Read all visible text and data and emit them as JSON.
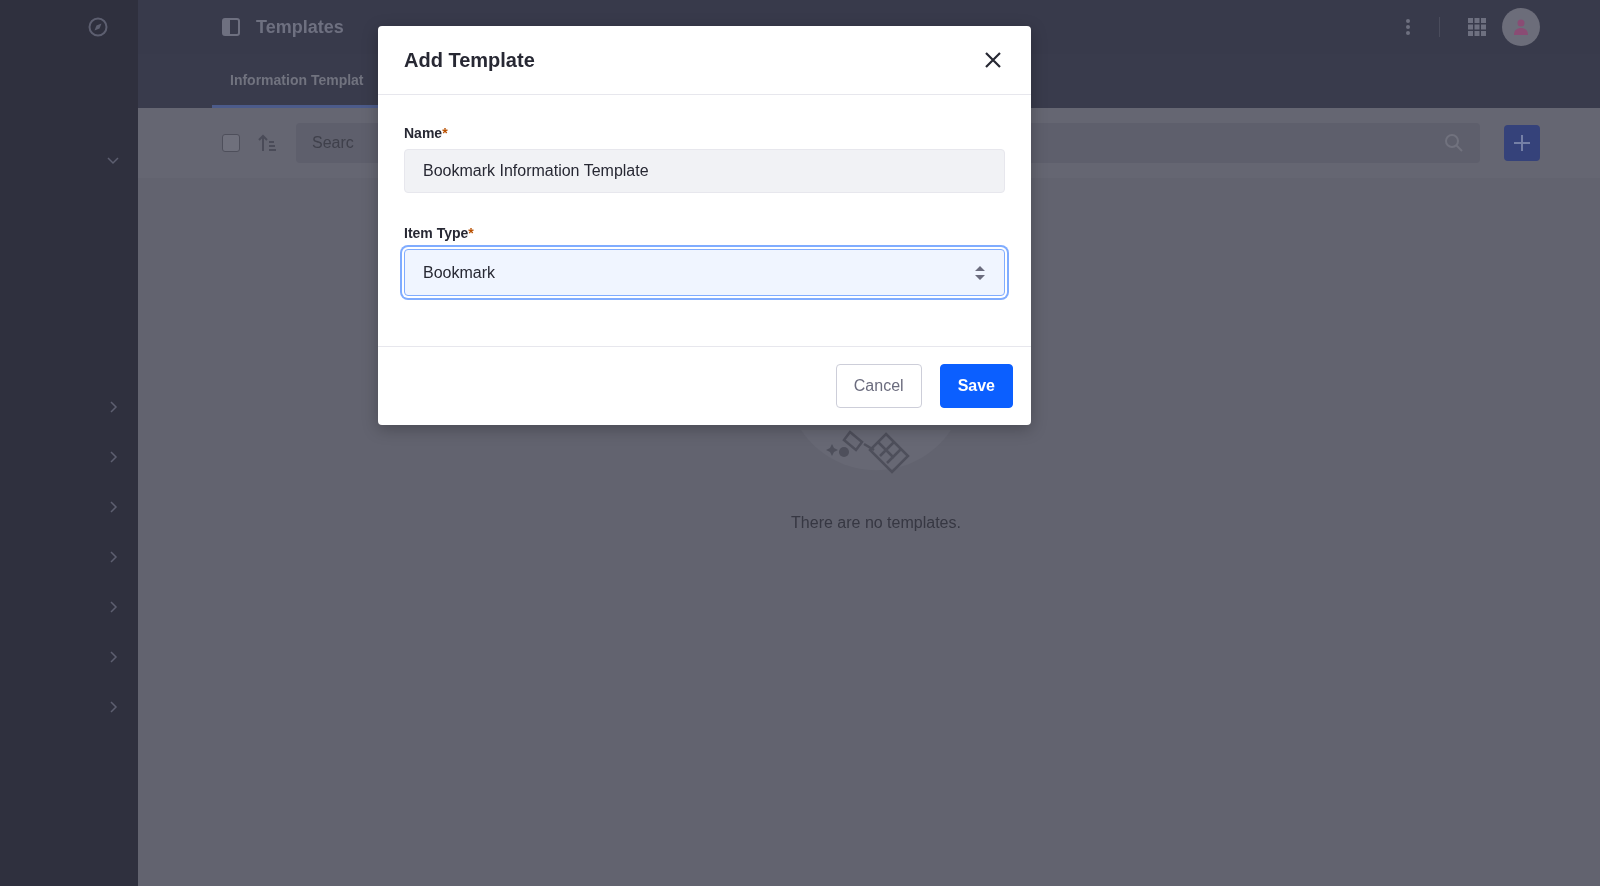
{
  "header": {
    "title": "Templates"
  },
  "tabs": [
    {
      "label": "Information Templat",
      "selected": true
    }
  ],
  "sidebar": {
    "sections": [
      {
        "expanded": true
      },
      {
        "expanded": false
      },
      {
        "expanded": false
      },
      {
        "expanded": false
      },
      {
        "expanded": false
      },
      {
        "expanded": false
      },
      {
        "expanded": false
      },
      {
        "expanded": false
      }
    ]
  },
  "toolbar": {
    "select_all": {
      "checked": false
    },
    "search": {
      "placeholder": "Searc"
    }
  },
  "empty_state": {
    "message": "There are no templates."
  },
  "dialog": {
    "title": "Add Template",
    "fields": [
      {
        "kind": "text",
        "label": "Name",
        "required_mark": "*",
        "value": "Bookmark Information Template",
        "focused": false
      },
      {
        "kind": "select",
        "label": "Item Type",
        "required_mark": "*",
        "value": "Bookmark",
        "focused": true
      }
    ],
    "buttons": [
      {
        "kind": "secondary",
        "label": "Cancel"
      },
      {
        "kind": "primary",
        "label": "Save"
      }
    ]
  }
}
